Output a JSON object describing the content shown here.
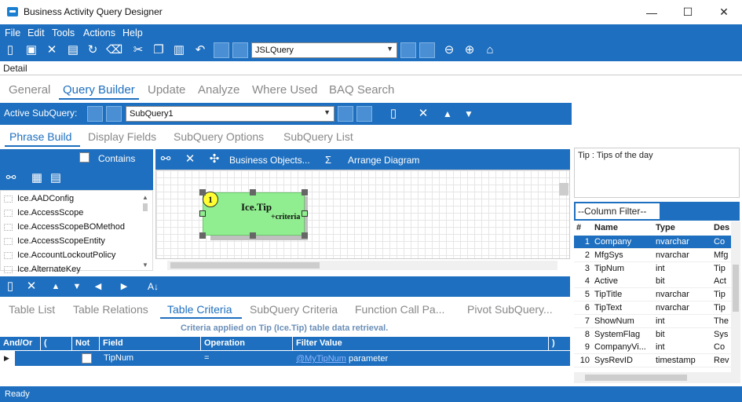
{
  "window": {
    "title": "Business Activity Query Designer",
    "minimize": "—",
    "maximize": "☐",
    "close": "✕"
  },
  "menu": [
    {
      "label": "File"
    },
    {
      "label": "Edit"
    },
    {
      "label": "Tools"
    },
    {
      "label": "Actions"
    },
    {
      "label": "Help"
    }
  ],
  "toolbar": {
    "query_select": "JSLQuery"
  },
  "detail_label": "Detail",
  "main_tabs": [
    "General",
    "Query Builder",
    "Update",
    "Analyze",
    "Where Used",
    "BAQ Search"
  ],
  "subquery": {
    "label": "Active SubQuery:",
    "value": "SubQuery1"
  },
  "inner_tabs": [
    "Phrase Build",
    "Display Fields",
    "SubQuery Options",
    "SubQuery List"
  ],
  "left_panel": {
    "contains_label": "Contains",
    "tables": [
      "Ice.AADConfig",
      "Ice.AccessScope",
      "Ice.AccessScopeBOMethod",
      "Ice.AccessScopeEntity",
      "Ice.AccountLockoutPolicy",
      "Ice.AlternateKey"
    ]
  },
  "diagram_toolbar": {
    "business_objects": "Business Objects...",
    "sigma": "Σ",
    "arrange": "Arrange Diagram"
  },
  "diagram_node": {
    "badge": "1",
    "name": "Ice.Tip",
    "criteria": "+criteria"
  },
  "tip_panel": {
    "text": "Tip : Tips of the day"
  },
  "column_filter": {
    "placeholder": "--Column Filter--",
    "headers": [
      "# ",
      "Name",
      "Type",
      "Des"
    ],
    "rows": [
      {
        "n": "1",
        "name": "Company",
        "type": "nvarchar",
        "desc": "Co"
      },
      {
        "n": "2",
        "name": "MfgSys",
        "type": "nvarchar",
        "desc": "Mfg"
      },
      {
        "n": "3",
        "name": "TipNum",
        "type": "int",
        "desc": "Tip"
      },
      {
        "n": "4",
        "name": "Active",
        "type": "bit",
        "desc": "Act"
      },
      {
        "n": "5",
        "name": "TipTitle",
        "type": "nvarchar",
        "desc": "Tip"
      },
      {
        "n": "6",
        "name": "TipText",
        "type": "nvarchar",
        "desc": "Tip"
      },
      {
        "n": "7",
        "name": "ShowNum",
        "type": "int",
        "desc": "The"
      },
      {
        "n": "8",
        "name": "SystemFlag",
        "type": "bit",
        "desc": "Sys"
      },
      {
        "n": "9",
        "name": "CompanyVi...",
        "type": "int",
        "desc": "Co"
      },
      {
        "n": "10",
        "name": "SysRevID",
        "type": "timestamp",
        "desc": "Rev"
      }
    ]
  },
  "bottom_tabs": [
    "Table List",
    "Table Relations",
    "Table Criteria",
    "SubQuery Criteria",
    "Function Call Pa...",
    "Pivot SubQuery..."
  ],
  "criteria": {
    "caption": "Criteria applied on Tip (Ice.Tip)  table data retrieval.",
    "headers": [
      "And/Or",
      "(",
      "Not",
      "Field",
      "Operation",
      "Filter Value",
      ")"
    ],
    "row": {
      "field": "TipNum",
      "operation": "=",
      "filter_link": "@MyTipNum",
      "filter_suffix": " parameter"
    }
  },
  "status": "Ready",
  "colors": {
    "accent": "#1e6fbf",
    "node_fill": "#90ee90",
    "link": "#1e40ff"
  }
}
